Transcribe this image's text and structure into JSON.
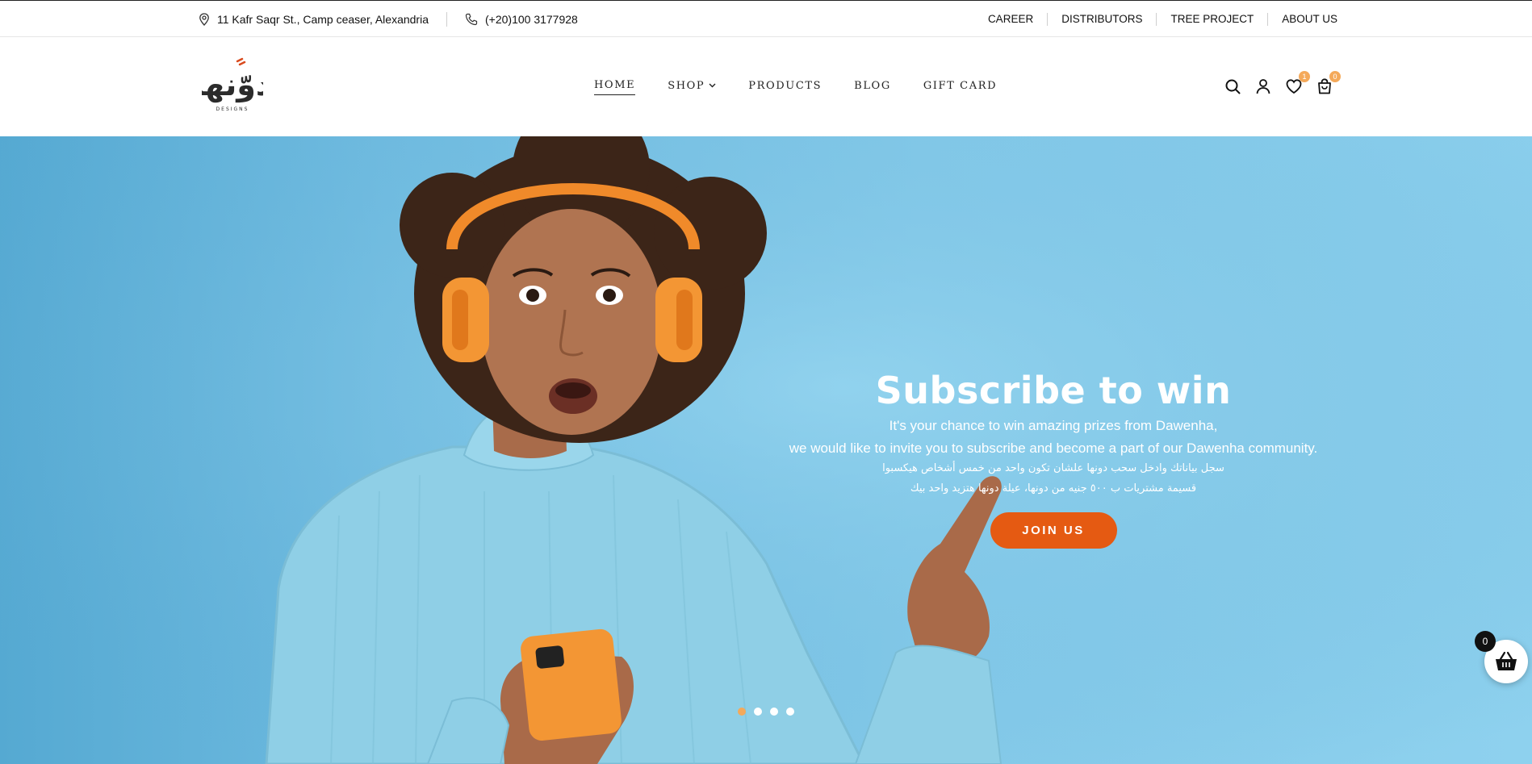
{
  "topbar": {
    "address": "11 Kafr Saqr St., Camp ceaser, Alexandria",
    "phone": "(+20)100 3177928",
    "links": [
      "CAREER",
      "DISTRIBUTORS",
      "TREE PROJECT",
      "ABOUT US"
    ],
    "icons": {
      "address": "map-pin-icon",
      "phone": "phone-icon"
    }
  },
  "header": {
    "logo_text": "دوّنها",
    "logo_subtext": "DESIGNS",
    "nav": [
      {
        "label": "HOME",
        "active": true
      },
      {
        "label": "SHOP",
        "dropdown": true
      },
      {
        "label": "PRODUCTS"
      },
      {
        "label": "BLOG"
      },
      {
        "label": "GIFT CARD"
      }
    ],
    "wishlist_count": "1",
    "cart_count": "0",
    "icons": [
      "search-icon",
      "user-icon",
      "heart-icon",
      "shopping-bag-icon"
    ]
  },
  "hero": {
    "title": "Subscribe to win",
    "subtitle_line1": "It's your chance to win amazing prizes from Dawenha,",
    "subtitle_line2": "we would like to invite you to subscribe and become a part of our Dawenha community.",
    "arabic_line1": "سجل بياناتك وادخل سحب دونها علشان تكون واحد من خمس أشخاص هيكسبوا",
    "arabic_line2": "قسيمة مشتريات ب ٥٠٠ جنيه من دونها، عيلة دونها هتزيد واحد بيك",
    "button_label": "JOIN US",
    "slides": 4,
    "active_slide": 1
  },
  "floating_cart": {
    "count": "0",
    "icon": "basket-icon"
  },
  "colors": {
    "accent": "#e55a12",
    "badge": "#f4a95a",
    "hero_bg": "#86cbea"
  }
}
